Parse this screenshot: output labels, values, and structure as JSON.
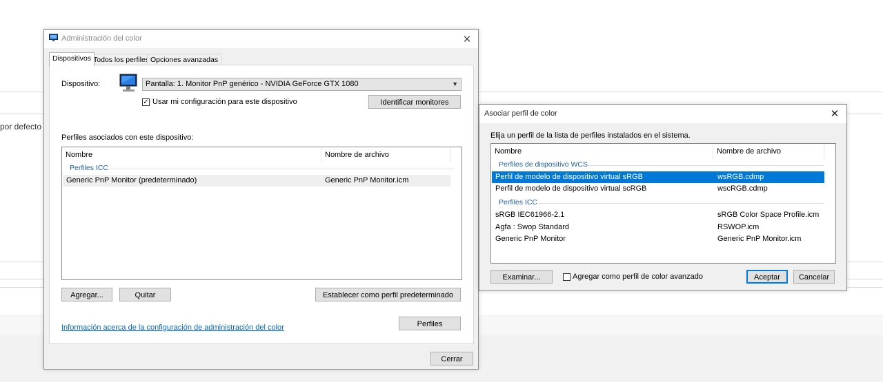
{
  "background": {
    "partial_text": "por defecto"
  },
  "color_management": {
    "title": "Administración del color",
    "tabs": [
      {
        "label": "Dispositivos",
        "active": true
      },
      {
        "label": "Todos los perfiles",
        "active": false
      },
      {
        "label": "Opciones avanzadas",
        "active": false
      }
    ],
    "device_label": "Dispositivo:",
    "device_value": "Pantalla: 1. Monitor PnP genérico - NVIDIA GeForce GTX 1080",
    "use_my_settings_label": "Usar mi configuración para este dispositivo",
    "use_my_settings_checked": true,
    "identify_button": "Identificar monitores",
    "profiles_label": "Perfiles asociados con este dispositivo:",
    "columns": [
      "Nombre",
      "Nombre de archivo"
    ],
    "groups": [
      {
        "name": "Perfiles ICC",
        "rows": [
          {
            "name": "Generic PnP Monitor (predeterminado)",
            "file": "Generic PnP Monitor.icm"
          }
        ]
      }
    ],
    "add_button": "Agregar...",
    "remove_button": "Quitar",
    "set_default_button": "Establecer como perfil predeterminado",
    "info_link": "Información acerca de la configuración de administración del color",
    "profiles_button": "Perfiles",
    "close_button": "Cerrar"
  },
  "associate_dialog": {
    "title": "Asociar perfil de color",
    "instruction": "Elija un perfil de la lista de perfiles instalados en el sistema.",
    "columns": [
      "Nombre",
      "Nombre de archivo"
    ],
    "groups": [
      {
        "name": "Perfiles de dispositivo WCS",
        "rows": [
          {
            "name": "Perfil de modelo de dispositivo virtual sRGB",
            "file": "wsRGB.cdmp",
            "selected": true
          },
          {
            "name": "Perfil de modelo de dispositivo virtual scRGB",
            "file": "wscRGB.cdmp",
            "selected": false
          }
        ]
      },
      {
        "name": "Perfiles ICC",
        "rows": [
          {
            "name": "sRGB IEC61966-2.1",
            "file": "sRGB Color Space Profile.icm"
          },
          {
            "name": "Agfa : Swop Standard",
            "file": "RSWOP.icm"
          },
          {
            "name": "Generic PnP Monitor",
            "file": "Generic PnP Monitor.icm"
          }
        ]
      }
    ],
    "browse_button": "Examinar...",
    "advanced_checkbox_label": "Agregar como perfil de color avanzado",
    "advanced_checked": false,
    "ok_button": "Aceptar",
    "cancel_button": "Cancelar"
  },
  "colors": {
    "selection": "#0078d7",
    "group_header": "#1e5fa0",
    "link": "#0066cc"
  }
}
